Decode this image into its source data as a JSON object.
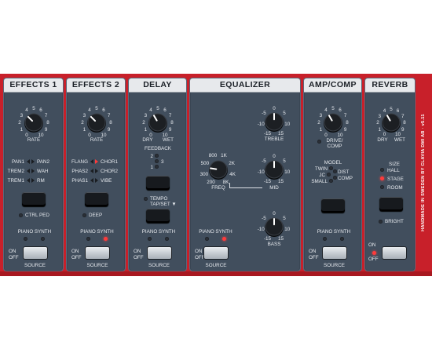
{
  "side_text": "HANDMADE IN SWEDEN BY CLAVIA DMI AB · v5.11",
  "panels": [
    {
      "title": "EFFECTS 1"
    },
    {
      "title": "EFFECTS 2"
    },
    {
      "title": "DELAY"
    },
    {
      "title": "EQUALIZER"
    },
    {
      "title": "AMP/COMP"
    },
    {
      "title": "REVERB"
    }
  ],
  "scale": {
    "n0": "0",
    "n1": "1",
    "n2": "2",
    "n3": "3",
    "n4": "4",
    "n5": "5",
    "n6": "6",
    "n7": "7",
    "n8": "8",
    "n9": "9",
    "n10": "10"
  },
  "eq_scale": {
    "m15": "-15",
    "m10": "-10",
    "m5": "-5",
    "z": "0",
    "p5": "5",
    "p10": "10",
    "p15": "15"
  },
  "freq_scale": {
    "f200": "200",
    "f300": "300",
    "f500": "500",
    "f800": "800",
    "f1k": "1K",
    "f2k": "2K",
    "f4k": "4K",
    "f8k": "8K"
  },
  "fx1": {
    "knob": "RATE",
    "pan1": "PAN1",
    "pan2": "PAN2",
    "trem2": "TREM2",
    "wah": "WAH",
    "trem1": "TREM1",
    "rm": "RM",
    "led": "CTRL PED"
  },
  "fx2": {
    "knob": "RATE",
    "flang": "FLANG",
    "chor1": "CHOR1",
    "phas2": "PHAS2",
    "chor2": "CHOR2",
    "phas1": "PHAS1",
    "vibe": "VIBE",
    "led": "DEEP"
  },
  "delay": {
    "dry": "DRY",
    "wet": "WET",
    "feedback": "FEEDBACK",
    "f1": "1",
    "f2": "2",
    "f3": "3",
    "tempo1": "TEMPO",
    "tempo2": "TAP/SET ▼"
  },
  "eq": {
    "treble": "TREBLE",
    "freq": "FREQ",
    "mid": "MID",
    "bass": "BASS"
  },
  "amp": {
    "drive1": "DRIVE/",
    "drive2": "COMP",
    "model": "MODEL",
    "twin": "TWIN",
    "dist": "DIST",
    "jc": "JC",
    "comp": "COMP",
    "small": "SMALL"
  },
  "reverb": {
    "dry": "DRY",
    "wet": "WET",
    "size": "SIZE",
    "hall": "HALL",
    "stage": "STAGE",
    "room": "ROOM",
    "bright": "BRIGHT"
  },
  "source": {
    "piano": "PIANO",
    "synth": "SYNTH",
    "on": "ON",
    "off": "OFF",
    "label": "SOURCE"
  },
  "knob_values": {
    "fx1_rate": 3.5,
    "fx2_rate": 3.5,
    "delay_mix": 4,
    "eq_treble": 0,
    "eq_freq": 1.6,
    "eq_mid": 0,
    "eq_bass": 0,
    "amp_drive": 4,
    "reverb_mix": 4
  },
  "led_states": {
    "fx1_source_synth": false,
    "fx2_source_synth": true,
    "delay_source_synth": false,
    "eq_source_synth": true,
    "amp_source_synth": false,
    "reverb_on": true,
    "fx2_flang": true,
    "reverb_stage": true
  }
}
